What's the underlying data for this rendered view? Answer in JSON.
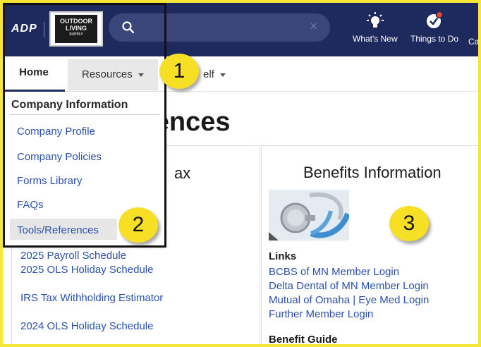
{
  "header": {
    "adp_logo": "ADP",
    "company_logo": {
      "line1": "OUTDOOR",
      "line2": "LIVING",
      "line3": "SUPPLY"
    },
    "search": {
      "placeholder": "",
      "clear_icon": "close-icon"
    },
    "whats_new": {
      "label": "What's New",
      "icon": "lightbulb-icon"
    },
    "things_to_do": {
      "label": "Things to Do",
      "icon": "checkmark-badge-icon"
    },
    "cut_label": "Ca"
  },
  "nav": {
    "home": "Home",
    "resources": "Resources",
    "myself_partial": "elf"
  },
  "dropdown": {
    "heading": "Company Information",
    "items": [
      "Company Profile",
      "Company Policies",
      "Forms Library",
      "FAQs",
      "Tools/References"
    ]
  },
  "page_title": "rences",
  "left_panel": {
    "title_partial": "ax",
    "links": [
      "2025 Payroll Schedule",
      "2025 OLS Holiday Schedule",
      "IRS Tax Withholding Estimator",
      "2024 OLS Holiday Schedule"
    ]
  },
  "right_panel": {
    "title": "Benefits Information",
    "image_icon": "stethoscope-image",
    "links_heading": "Links",
    "links": [
      "BCBS of MN Member Login",
      "Delta Dental of MN Member Login",
      "Mutual of Omaha | Eye Med Login",
      "Further Member Login"
    ],
    "guide_heading": "Benefit Guide"
  },
  "callouts": [
    "1",
    "2",
    "3"
  ],
  "colors": {
    "header_bg": "#1e2a5e",
    "link": "#2d50a8",
    "callout": "#f6df25",
    "frame": "#f7e63a"
  }
}
